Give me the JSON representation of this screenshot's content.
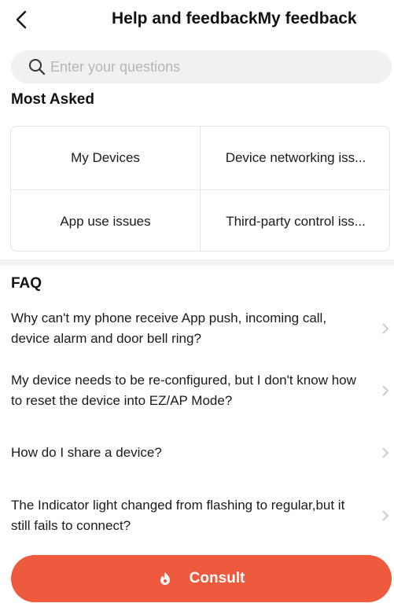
{
  "header": {
    "back_icon": "chevron-left-icon",
    "title": "Help and feedback",
    "right_link": "My feedback"
  },
  "search": {
    "icon": "search-icon",
    "placeholder": "Enter your questions"
  },
  "most_asked": {
    "title": "Most Asked",
    "items": [
      {
        "label": "My Devices"
      },
      {
        "label": "Device networking iss..."
      },
      {
        "label": "App use issues"
      },
      {
        "label": "Third-party control iss..."
      }
    ]
  },
  "faq": {
    "title": "FAQ",
    "items": [
      {
        "question": "Why can't my phone receive App push, incoming call, device alarm and door bell ring?"
      },
      {
        "question": "My device needs to be re-configured, but I don't know how to reset the device into EZ/AP Mode?"
      },
      {
        "question": "How do I share a device?"
      },
      {
        "question": "The Indicator light changed from flashing to regular,but it still fails to connect?"
      }
    ]
  },
  "consult_button": {
    "label": "Consult",
    "icon": "flame-icon",
    "color": "#ee5a3e"
  }
}
